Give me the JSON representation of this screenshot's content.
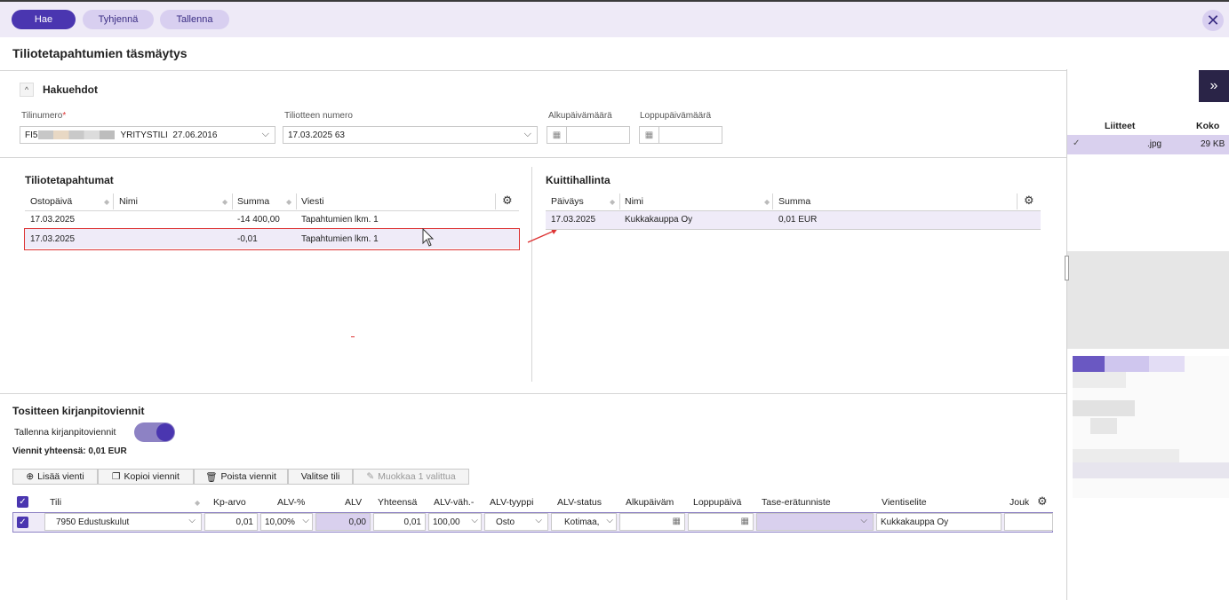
{
  "toolbar": {
    "search": "Hae",
    "clear": "Tyhjennä",
    "save": "Tallenna",
    "close": "✕"
  },
  "page": {
    "title": "Tiliotetapahtumien täsmäytys"
  },
  "criteria": {
    "title": "Hakuehdot",
    "account_label": "Tilinumero",
    "account_prefix": "FI5",
    "account_name": "YRITYSTILI",
    "account_date": "27.06.2016",
    "statement_label": "Tiliotteen numero",
    "statement_value": "17.03.2025 63",
    "start_label": "Alkupäivämäärä",
    "end_label": "Loppupäivämäärä"
  },
  "transactions": {
    "title": "Tiliotetapahtumat",
    "columns": [
      "Ostopäivä",
      "Nimi",
      "Summa",
      "Viesti"
    ],
    "rows": [
      {
        "date": "17.03.2025",
        "name": "",
        "amount": "-14 400,00",
        "message": "Tapahtumien lkm. 1"
      },
      {
        "date": "17.03.2025",
        "name": "",
        "amount": "-0,01",
        "message": "Tapahtumien lkm. 1"
      }
    ]
  },
  "receipts": {
    "title": "Kuittihallinta",
    "columns": [
      "Päiväys",
      "Nimi",
      "Summa"
    ],
    "rows": [
      {
        "date": "17.03.2025",
        "name": "Kukkakauppa Oy",
        "amount": "0,01 EUR"
      }
    ]
  },
  "attachments": {
    "columns": [
      "Liitteet",
      "Koko"
    ],
    "rows": [
      {
        "file": ".jpg",
        "size": "29 KB"
      }
    ]
  },
  "entries": {
    "title": "Tositteen kirjanpitoviennit",
    "save_label": "Tallenna kirjanpitoviennit",
    "total": "Viennit yhteensä: 0,01 EUR",
    "buttons": {
      "add": "Lisää vienti",
      "copy": "Kopioi viennit",
      "delete": "Poista viennit",
      "choose": "Valitse tili",
      "edit": "Muokkaa 1 valittua"
    },
    "columns": [
      "Tili",
      "Kp-arvo",
      "ALV-%",
      "ALV",
      "Yhteensä",
      "ALV-väh.-",
      "ALV-tyyppi",
      "ALV-status",
      "Alkupäiväm",
      "Loppupäivä",
      "Tase-erätunniste",
      "Vientiselite",
      "Jouk"
    ],
    "row": {
      "account": "7950 Edustuskulut",
      "kp": "0,01",
      "vat_pct": "10,00%",
      "vat": "0,00",
      "total": "0,01",
      "deduct": "100,00",
      "vat_type": "Osto",
      "vat_status": "Kotimaa,",
      "desc": "Kukkakauppa Oy"
    }
  },
  "colors": {
    "accent": "#4a36b0",
    "accent_light": "#d8cff0",
    "highlight": "#efebf8",
    "alert": "#dd3333"
  }
}
